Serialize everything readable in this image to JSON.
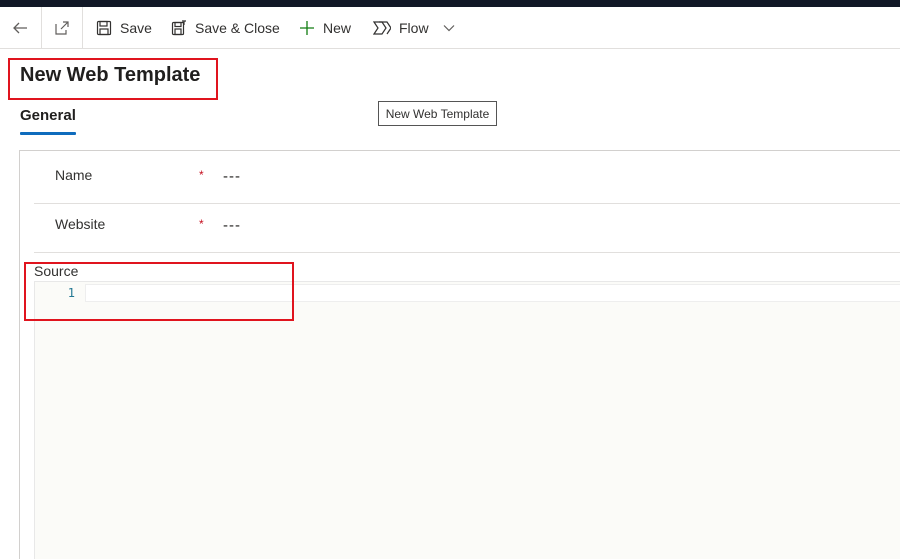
{
  "commandbar": {
    "back_icon": "arrow-left-icon",
    "popout_icon": "open-in-new-window-icon",
    "save_label": "Save",
    "save_close_label": "Save & Close",
    "new_label": "New",
    "flow_label": "Flow"
  },
  "header": {
    "title": "New Web Template",
    "tooltip": "New Web Template"
  },
  "tabs": [
    {
      "label": "General",
      "selected": true
    }
  ],
  "form": {
    "fields": [
      {
        "label": "Name",
        "required_marker": "*",
        "value": "---"
      },
      {
        "label": "Website",
        "required_marker": "*",
        "value": "---"
      }
    ],
    "source": {
      "label": "Source",
      "line_numbers": [
        "1"
      ]
    }
  },
  "colors": {
    "accent": "#0f6cbd",
    "highlight_box": "#e0141e",
    "required": "#c50f1f",
    "line_number": "#237893",
    "new_icon": "#107c10"
  }
}
